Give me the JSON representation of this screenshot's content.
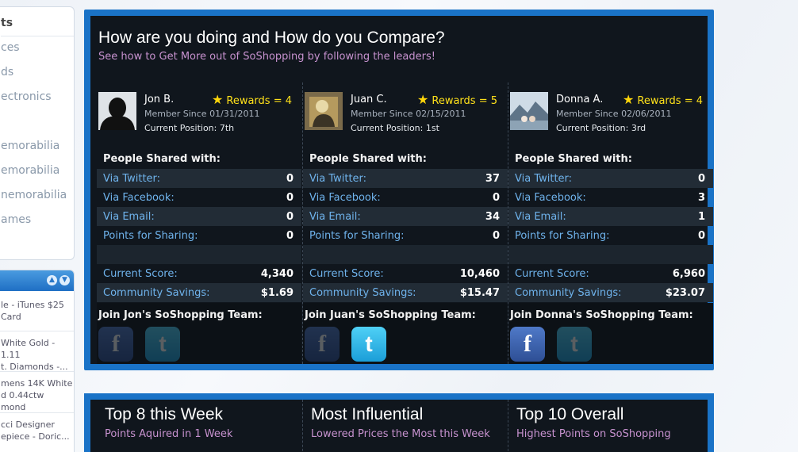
{
  "sidebar": {
    "categories": [
      "ts",
      "ces",
      "ds",
      "ectronics",
      "emorabilia",
      "emorabilia",
      "nemorabilia",
      "ames"
    ],
    "products": [
      [
        "le - iTunes $25",
        "Card"
      ],
      [
        "White Gold - 1.11",
        "t. Diamonds -..."
      ],
      [
        "mens 14K White",
        "d 0.44ctw",
        "mond"
      ],
      [
        "cci Designer",
        "epiece - Doric..."
      ]
    ]
  },
  "compare": {
    "title": "How are you doing and How do you Compare?",
    "subtitle": "See how to Get More out of SoShopping by following the leaders!",
    "users": [
      {
        "name": "Jon B.",
        "rewards": "Rewards = 4",
        "member_since": "Member Since 01/31/2011",
        "position": "Current Position: 7th",
        "shared_header": "People Shared with:",
        "twitter_label": "Via Twitter:",
        "twitter": "0",
        "facebook_label": "Via Facebook:",
        "facebook": "0",
        "email_label": "Via Email:",
        "email": "0",
        "points_label": "Points for Sharing:",
        "points": "0",
        "score_label": "Current Score:",
        "score": "4,340",
        "savings_label": "Community Savings:",
        "savings": "$1.69",
        "join": "Join Jon's SoShopping Team:",
        "fb_active": false,
        "tw_active": false
      },
      {
        "name": "Juan C.",
        "rewards": "Rewards = 5",
        "member_since": "Member Since 02/15/2011",
        "position": "Current Position: 1st",
        "shared_header": "People Shared with:",
        "twitter_label": "Via Twitter:",
        "twitter": "37",
        "facebook_label": "Via Facebook:",
        "facebook": "0",
        "email_label": "Via Email:",
        "email": "34",
        "points_label": "Points for Sharing:",
        "points": "0",
        "score_label": "Current Score:",
        "score": "10,460",
        "savings_label": "Community Savings:",
        "savings": "$15.47",
        "join": "Join Juan's SoShopping Team:",
        "fb_active": false,
        "tw_active": true
      },
      {
        "name": "Donna A.",
        "rewards": "Rewards = 4",
        "member_since": "Member Since 02/06/2011",
        "position": "Current Position: 3rd",
        "shared_header": "People Shared with:",
        "twitter_label": "Via Twitter:",
        "twitter": "0",
        "facebook_label": "Via Facebook:",
        "facebook": "3",
        "email_label": "Via Email:",
        "email": "1",
        "points_label": "Points for Sharing:",
        "points": "0",
        "score_label": "Current Score:",
        "score": "6,960",
        "savings_label": "Community Savings:",
        "savings": "$23.07",
        "join": "Join Donna's SoShopping Team:",
        "fb_active": true,
        "tw_active": false
      }
    ]
  },
  "leaders": [
    {
      "title": "Top 8 this Week",
      "subtitle": "Points Aquired in 1 Week"
    },
    {
      "title": "Most Influential",
      "subtitle": "Lowered Prices the Most this Week"
    },
    {
      "title": "Top 10 Overall",
      "subtitle": "Highest Points on SoShopping"
    }
  ],
  "icons": {
    "star": "star-icon",
    "facebook": "facebook-icon",
    "twitter": "twitter-icon",
    "collapse": "chevron-up-icon",
    "expand": "chevron-down-icon"
  },
  "colors": {
    "panel_border": "#1a73c7",
    "panel_bg": "#10161d",
    "label_blue": "#6fb3ec",
    "subtitle_purple": "#c792cf",
    "rewards_yellow": "#ffe11a"
  }
}
